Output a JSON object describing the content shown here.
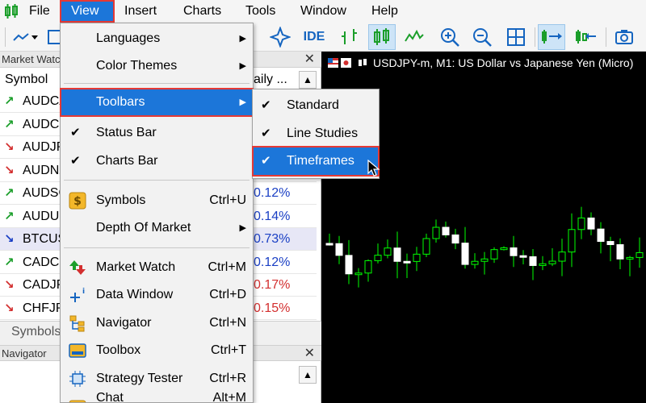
{
  "menubar": {
    "items": [
      {
        "label": "File"
      },
      {
        "label": "View"
      },
      {
        "label": "Insert"
      },
      {
        "label": "Charts"
      },
      {
        "label": "Tools"
      },
      {
        "label": "Window"
      },
      {
        "label": "Help"
      }
    ]
  },
  "toolbar": {
    "ide_label": "IDE"
  },
  "market_watch": {
    "title": "Market Watc",
    "col_symbol": "Symbol",
    "col_daily": "aily ...",
    "rows": [
      {
        "symbol": "AUDCA",
        "pct": "",
        "dir": "up"
      },
      {
        "symbol": "AUDCH",
        "pct": "",
        "dir": "up"
      },
      {
        "symbol": "AUDJP",
        "pct": "",
        "dir": "down"
      },
      {
        "symbol": "AUDNZ",
        "pct": "",
        "dir": "down"
      },
      {
        "symbol": "AUDSG",
        "pct": "",
        "dir": "up"
      },
      {
        "symbol": "AUDUS",
        "pct": "0.14%",
        "dir": "up"
      },
      {
        "symbol": "BTCUS",
        "pct": "0.73%",
        "dir": "blue"
      },
      {
        "symbol": "CADCH",
        "pct": "0.12%",
        "dir": "up"
      },
      {
        "symbol": "CADJP",
        "pct": "0.17%",
        "dir": "down"
      },
      {
        "symbol": "CHFJP",
        "pct": "0.15%",
        "dir": "down"
      }
    ],
    "first_pct": "0.12%"
  },
  "symbols_tab": {
    "label": "Symbols"
  },
  "navigator": {
    "title": "Navigator"
  },
  "chart": {
    "title": "USDJPY-m, M1:  US Dollar vs Japanese Yen (Micro)",
    "up_color": "#00ff00",
    "bg_color": "#000000"
  },
  "view_menu": {
    "items": [
      {
        "label": "Languages",
        "shortcut": "",
        "submenu": true
      },
      {
        "label": "Color Themes",
        "shortcut": "",
        "submenu": true
      },
      {
        "label": "Toolbars",
        "shortcut": "",
        "submenu": true,
        "selected": true
      },
      {
        "label": "Status Bar",
        "shortcut": "",
        "checked": true
      },
      {
        "label": "Charts Bar",
        "shortcut": "",
        "checked": true
      },
      {
        "label": "Symbols",
        "shortcut": "Ctrl+U"
      },
      {
        "label": "Depth Of Market",
        "shortcut": "",
        "submenu": true
      },
      {
        "label": "Market Watch",
        "shortcut": "Ctrl+M"
      },
      {
        "label": "Data Window",
        "shortcut": "Ctrl+D"
      },
      {
        "label": "Navigator",
        "shortcut": "Ctrl+N"
      },
      {
        "label": "Toolbox",
        "shortcut": "Ctrl+T"
      },
      {
        "label": "Strategy Tester",
        "shortcut": "Ctrl+R"
      },
      {
        "label": "Chat",
        "shortcut": "Alt+M"
      }
    ]
  },
  "toolbars_submenu": {
    "items": [
      {
        "label": "Standard",
        "checked": true
      },
      {
        "label": "Line Studies",
        "checked": true
      },
      {
        "label": "Timeframes",
        "checked": true,
        "selected": true
      }
    ]
  },
  "accent_color": "#1c76d9",
  "highlight_color": "#e53935"
}
